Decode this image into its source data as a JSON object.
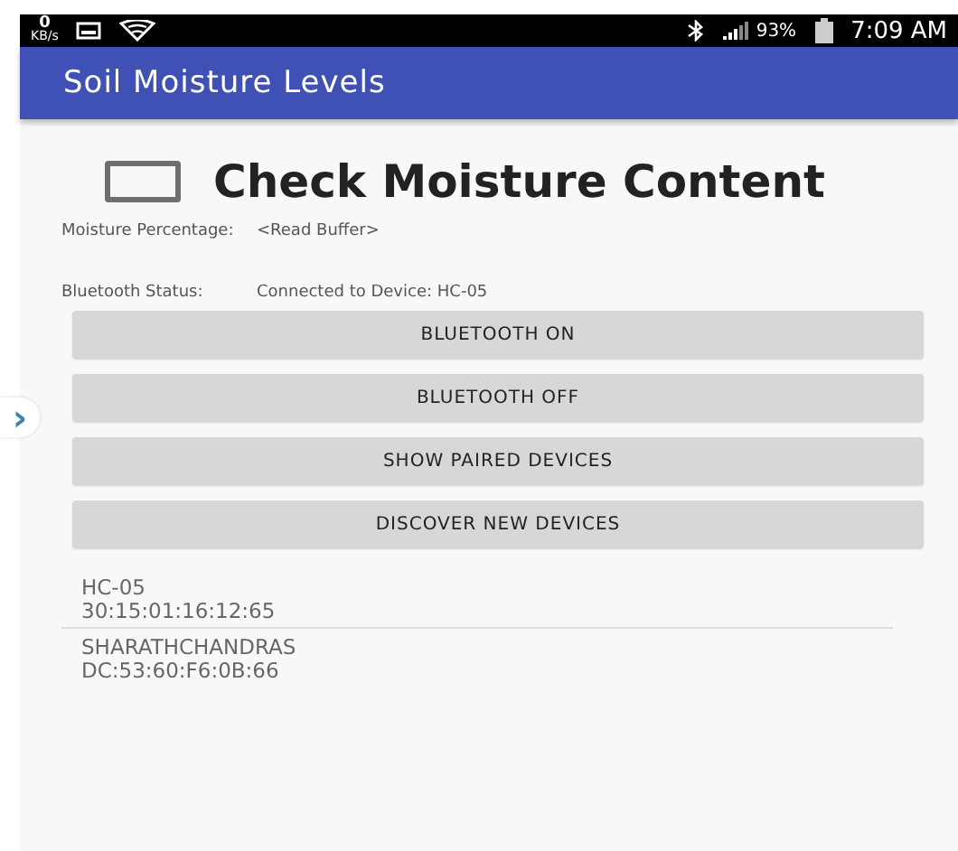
{
  "status_bar": {
    "speed_value": "0",
    "speed_unit": "KB/s",
    "battery_percent": "93%",
    "time": "7:09 AM"
  },
  "app_bar": {
    "title": "Soil Moisture Levels"
  },
  "check": {
    "label": "Check Moisture Content",
    "checked": false
  },
  "fields": [
    {
      "label": "Moisture Percentage:",
      "value": "<Read Buffer>"
    },
    {
      "label": "Bluetooth Status:",
      "value": "Connected to Device: HC-05"
    }
  ],
  "buttons": [
    "BLUETOOTH ON",
    "BLUETOOTH OFF",
    "SHOW PAIRED DEVICES",
    "DISCOVER NEW DEVICES"
  ],
  "devices": [
    {
      "name": "HC-05",
      "address": "30:15:01:16:12:65"
    },
    {
      "name": "SHARATHCHANDRAS",
      "address": "DC:53:60:F6:0B:66"
    }
  ],
  "side_handle": {
    "glyph": "›"
  }
}
